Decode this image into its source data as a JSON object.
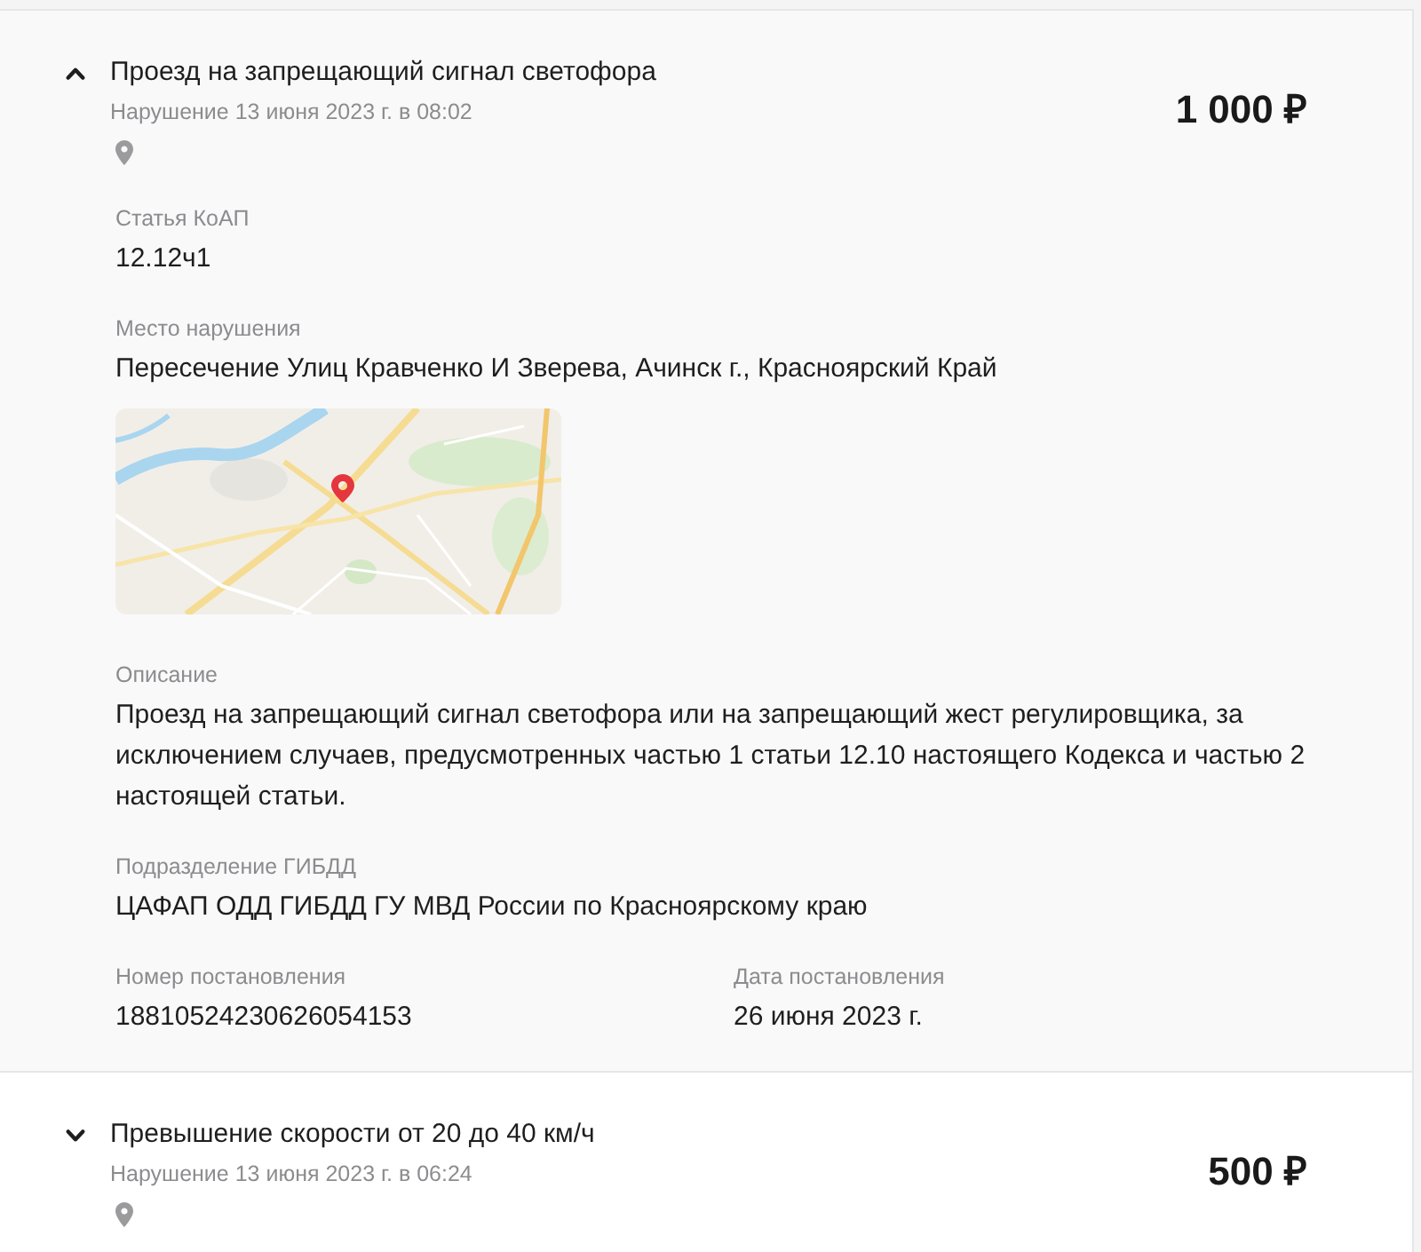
{
  "fines": [
    {
      "expanded": true,
      "title": "Проезд на запрещающий сигнал светофора",
      "subtitle": "Нарушение 13 июня 2023 г. в 08:02",
      "amount": "1 000 ₽",
      "details": [
        {
          "kind": "field",
          "label": "Статья КоАП",
          "value": "12.12ч1"
        },
        {
          "kind": "field",
          "label": "Место нарушения",
          "value": "Пересечение Улиц Кравченко И Зверева, Ачинск г., Красноярский Край"
        },
        {
          "kind": "map"
        },
        {
          "kind": "field",
          "label": "Описание",
          "value": "Проезд на запрещающий сигнал светофора или на запрещающий жест регулировщика, за исключением случаев, предусмотренных частью 1 статьи 12.10 настоящего Кодекса и частью 2 настоящей статьи."
        },
        {
          "kind": "field",
          "label": "Подразделение ГИБДД",
          "value": "ЦАФАП ОДД ГИБДД ГУ МВД России по Красноярскому краю"
        },
        {
          "kind": "pair",
          "fields": [
            {
              "label": "Номер постановления",
              "value": "18810524230626054153"
            },
            {
              "label": "Дата постановления",
              "value": "26 июня 2023 г."
            }
          ]
        }
      ]
    },
    {
      "expanded": false,
      "title": "Превышение скорости от 20 до 40 км/ч",
      "subtitle": "Нарушение 13 июня 2023 г. в 06:24",
      "amount": "500 ₽"
    }
  ]
}
